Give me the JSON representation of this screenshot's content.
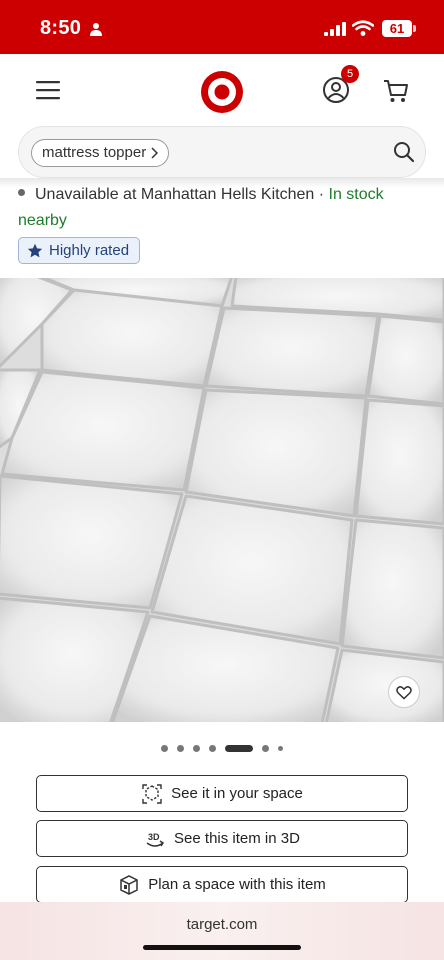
{
  "status_bar": {
    "time": "8:50",
    "battery": "61"
  },
  "header": {
    "cart_count": "5"
  },
  "search": {
    "query_chip": "mattress topper"
  },
  "availability": {
    "store_text": "Unavailable at Manhattan Hells Kitchen",
    "separator": " · ",
    "stock_text": "In stock",
    "stock_suffix": "nearby",
    "rating_badge": "Highly rated"
  },
  "carousel": {
    "total_images": 7,
    "active_index": 4
  },
  "actions": {
    "see_in_space": "See it in your space",
    "see_3d": "See this item in 3D",
    "plan_space": "Plan a space with this item"
  },
  "browser": {
    "domain": "target.com"
  },
  "colors": {
    "brand": "#cc0000",
    "in_stock": "#1d7d2a"
  }
}
